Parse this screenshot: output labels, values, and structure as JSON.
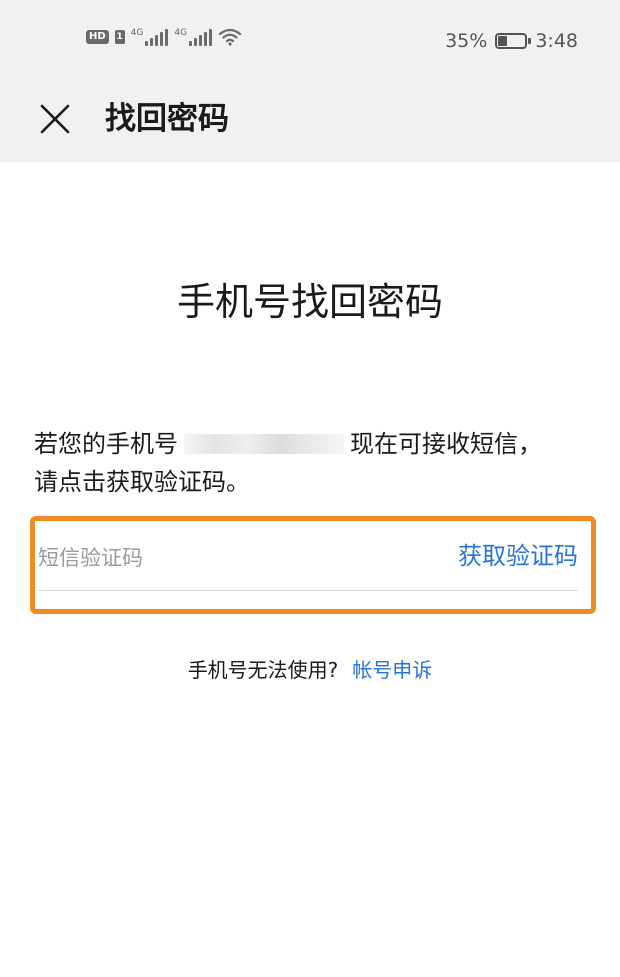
{
  "status_bar": {
    "hd_label": "HD",
    "sim_label": "1",
    "network_1": "4G",
    "network_2": "4G",
    "battery_percent": "35%",
    "battery_level": 0.35,
    "time": "3:48",
    "icons": [
      "hd-icon",
      "sim-icon",
      "signal-icon",
      "signal-icon",
      "wifi-icon",
      "battery-icon"
    ]
  },
  "header": {
    "close_icon": "close-icon",
    "title": "找回密码"
  },
  "main": {
    "title": "手机号找回密码",
    "desc_prefix": "若您的手机号",
    "desc_suffix": "现在可接收短信，请点击获取验证码。",
    "sms_input_placeholder": "短信验证码",
    "get_code_label": "获取验证码"
  },
  "footer": {
    "unavailable_text": "手机号无法使用?",
    "appeal_link": "帐号申诉"
  },
  "colors": {
    "accent": "#2673d9",
    "highlight": "#f08a24",
    "header_bg": "#f1f1f1"
  }
}
